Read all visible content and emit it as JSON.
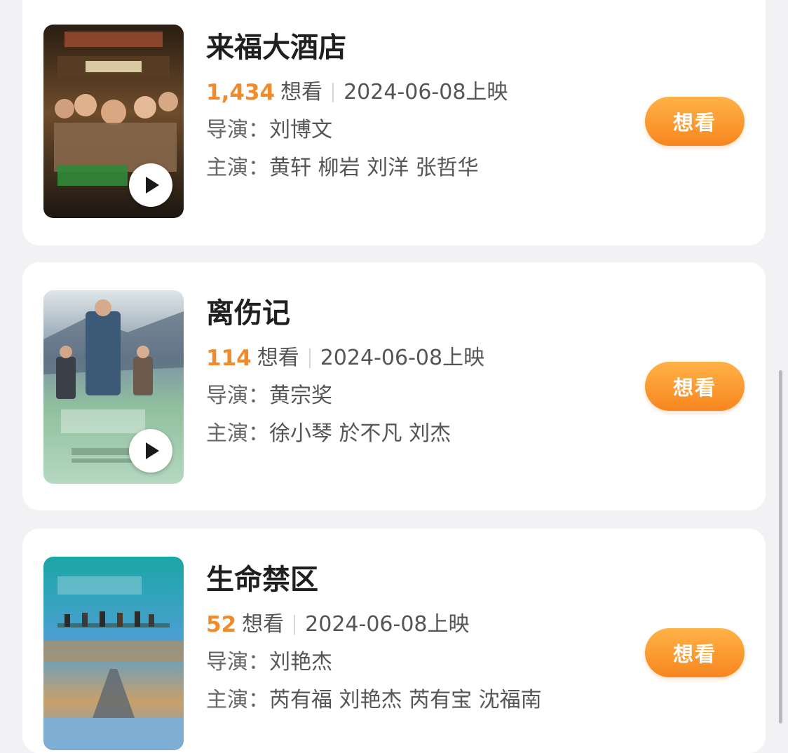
{
  "movies": [
    {
      "title": "来福大酒店",
      "want_count": "1,434",
      "want_label": "想看",
      "release": "2024-06-08上映",
      "director_label": "导演：",
      "director": "刘博文",
      "cast_label": "主演：",
      "cast": "黄轩 柳岩 刘洋 张哲华",
      "button": "想看",
      "poster_colors": [
        "#3b2a1c",
        "#7a5a36",
        "#2f5d3a"
      ]
    },
    {
      "title": "离伤记",
      "want_count": "114",
      "want_label": "想看",
      "release": "2024-06-08上映",
      "director_label": "导演：",
      "director": "黄宗奖",
      "cast_label": "主演：",
      "cast": "徐小琴 於不凡 刘杰",
      "button": "想看",
      "poster_colors": [
        "#8fb9a0",
        "#4a6278",
        "#a7d0b4"
      ]
    },
    {
      "title": "生命禁区",
      "want_count": "52",
      "want_label": "想看",
      "release": "2024-06-08上映",
      "director_label": "导演：",
      "director": "刘艳杰",
      "cast_label": "主演：",
      "cast": "芮有福 刘艳杰 芮有宝 沈福南",
      "button": "想看",
      "poster_colors": [
        "#1fa3a3",
        "#2e86c1",
        "#c49a63"
      ]
    }
  ],
  "colors": {
    "accent": "#f08a2b",
    "button_top": "#ffb247",
    "button_bottom": "#f7861f",
    "background": "#f2f2f4"
  }
}
